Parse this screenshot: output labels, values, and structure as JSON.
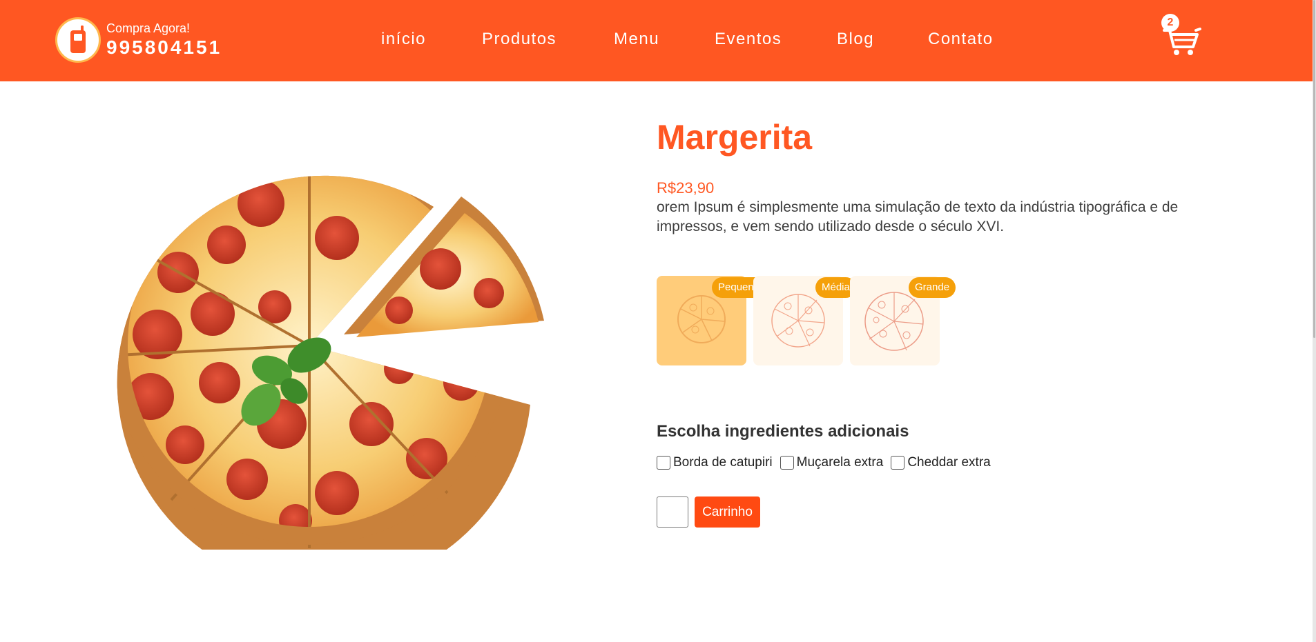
{
  "header": {
    "phone_label": "Compra Agora!",
    "phone_number": "995804151",
    "nav": [
      "início",
      "Produtos",
      "Menu",
      "Eventos",
      "Blog",
      "Contato"
    ],
    "cart_count": "2"
  },
  "product": {
    "title": "Margerita",
    "price": "R$23,90",
    "description": "orem Ipsum é simplesmente uma simulação de texto da indústria tipográfica e de impressos, e vem sendo utilizado desde o século XVI.",
    "sizes": [
      {
        "label": "Pequena",
        "selected": true
      },
      {
        "label": "Média",
        "selected": false
      },
      {
        "label": "Grande",
        "selected": false
      }
    ],
    "extras_title": "Escolha ingredientes adicionais",
    "extras": [
      "Borda de catupiri",
      "Muçarela extra",
      "Cheddar extra"
    ],
    "quantity": "",
    "cart_button_label": "Carrinho"
  },
  "colors": {
    "primary": "#ff5722",
    "accent": "#f5a00a",
    "selected_size_bg": "#ffcc7a",
    "size_bg": "#fff6ea"
  },
  "icons": {
    "phone": "mobile-phone-icon",
    "cart": "shopping-cart-icon",
    "size": "pizza-outline-icon"
  }
}
